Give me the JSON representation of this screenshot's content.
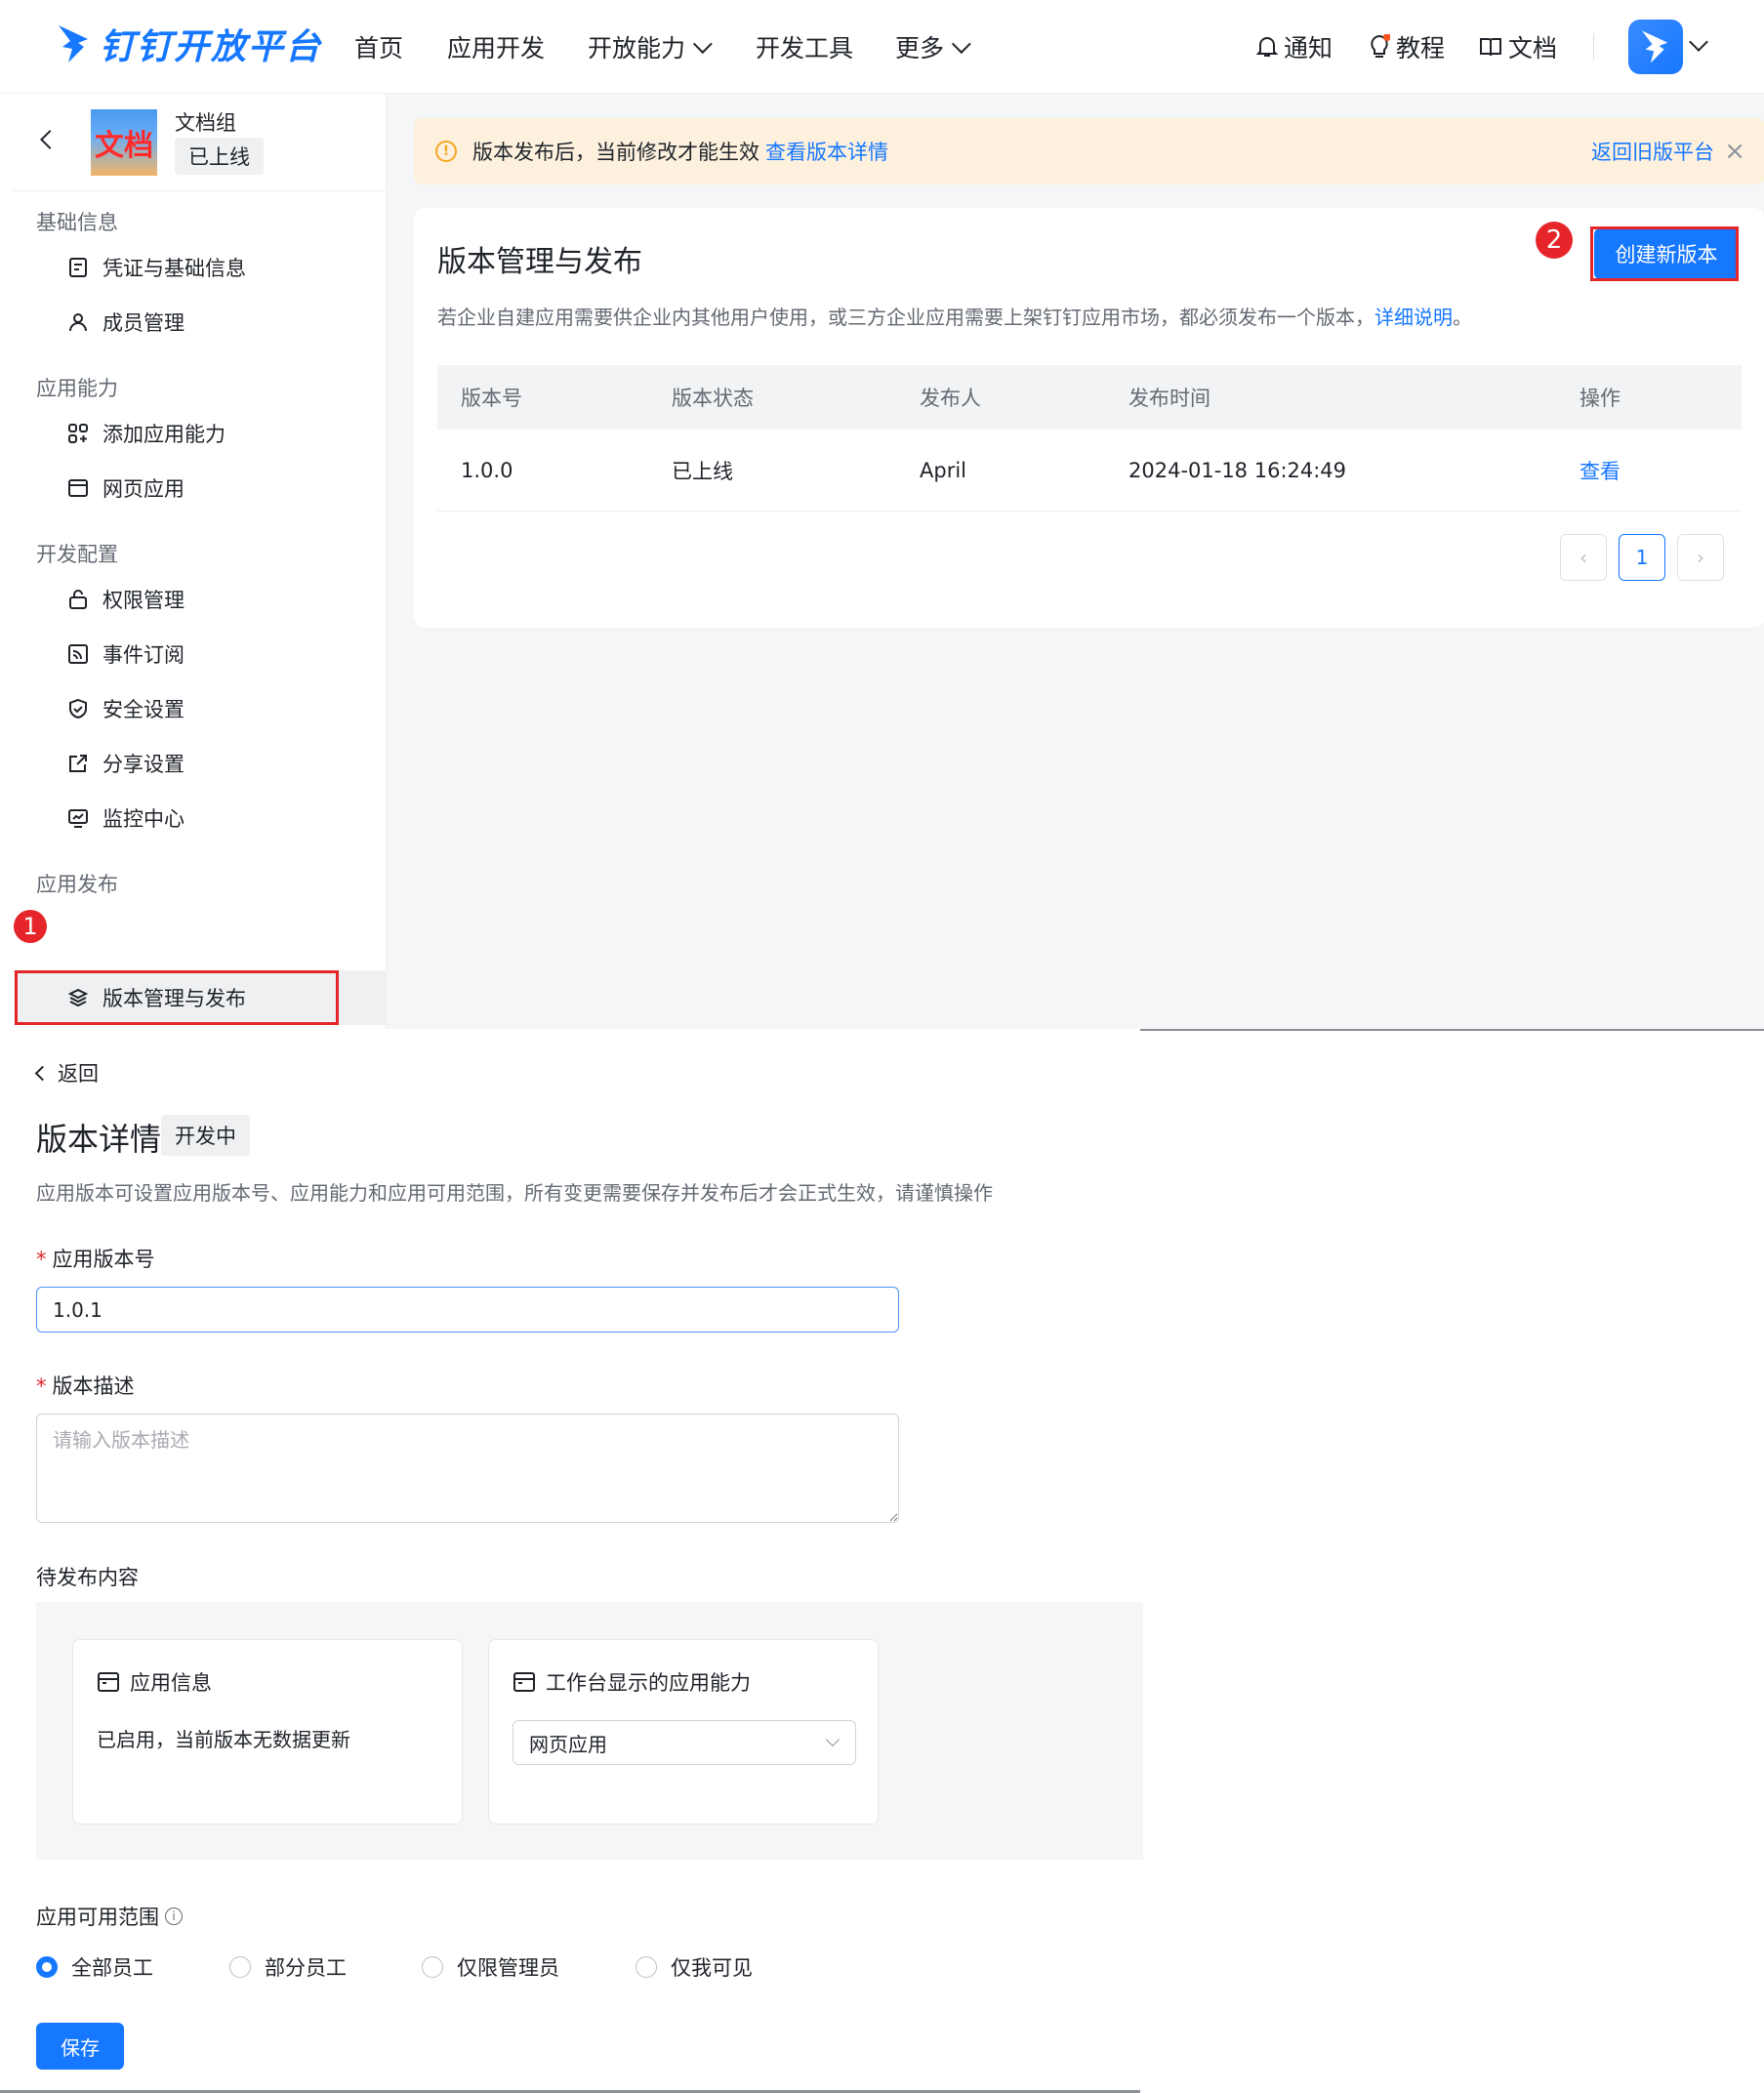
{
  "topnav": {
    "logo": "钉钉开放平台",
    "items": [
      "首页",
      "应用开发",
      "开放能力",
      "开发工具",
      "更多"
    ],
    "right": {
      "notify": "通知",
      "tutorial": "教程",
      "docs": "文档"
    }
  },
  "sidebar": {
    "app_logo_text": "文档",
    "app_name": "文档组",
    "app_status": "已上线",
    "groups": [
      "基础信息",
      "应用能力",
      "开发配置",
      "应用发布"
    ],
    "items": [
      "凭证与基础信息",
      "成员管理",
      "添加应用能力",
      "网页应用",
      "权限管理",
      "事件订阅",
      "安全设置",
      "分享设置",
      "监控中心",
      "版本管理与发布"
    ],
    "step_marker": "1"
  },
  "notice": {
    "text": "版本发布后，当前修改才能生效",
    "link": "查看版本详情",
    "back": "返回旧版平台"
  },
  "card": {
    "title": "版本管理与发布",
    "desc": "若企业自建应用需要供企业内其他用户使用，或三方企业应用需要上架钉钉应用市场，都必须发布一个版本，",
    "desc_link": "详细说明",
    "desc_end": "。",
    "create_button": "创建新版本",
    "step_marker": "2",
    "columns": [
      "版本号",
      "版本状态",
      "发布人",
      "发布时间",
      "操作"
    ],
    "rows": [
      {
        "version": "1.0.0",
        "status": "已上线",
        "publisher": "April",
        "time": "2024-01-18 16:24:49",
        "action": "查看"
      }
    ],
    "page": "1"
  },
  "detail": {
    "back": "返回",
    "title": "版本详情",
    "badge": "开发中",
    "desc": "应用版本可设置应用版本号、应用能力和应用可用范围，所有变更需要保存并发布后才会正式生效，请谨慎操作",
    "version_label": "应用版本号",
    "version_value": "1.0.1",
    "desc_label": "版本描述",
    "desc_placeholder": "请输入版本描述",
    "pending_label": "待发布内容",
    "card_info_title": "应用信息",
    "card_info_text": "已启用，当前版本无数据更新",
    "card_cap_title": "工作台显示的应用能力",
    "card_cap_value": "网页应用",
    "scope_label": "应用可用范围",
    "scope_options": [
      "全部员工",
      "部分员工",
      "仅限管理员",
      "仅我可见"
    ],
    "scope_selected": "全部员工",
    "save": "保存"
  },
  "colors": {
    "accent": "#1677ff",
    "marker": "#e5252a",
    "notice_bg": "#fdf1de"
  }
}
